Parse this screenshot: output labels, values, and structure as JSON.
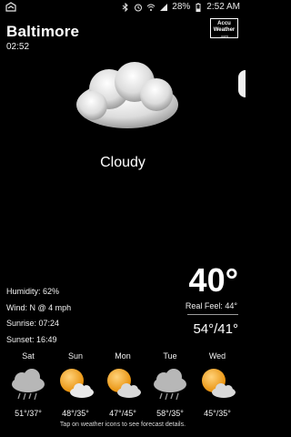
{
  "status_bar": {
    "battery": "28%",
    "time": "2:52 AM",
    "icons": [
      "notification-icon",
      "bluetooth-icon",
      "alarm-icon",
      "wifi-icon",
      "signal-icon",
      "battery-icon"
    ]
  },
  "location": {
    "city": "Baltimore",
    "time": "02:52"
  },
  "brand": {
    "line1": "Accu",
    "line2": "Weather",
    "line3": ".com"
  },
  "current": {
    "condition": "Cloudy",
    "temperature": "40°",
    "real_feel": "Real Feel: 44°",
    "hi_lo": "54°/41°",
    "humidity": "Humidity: 62%",
    "wind": "Wind: N @ 4 mph",
    "sunrise": "Sunrise: 07:24",
    "sunset": "Sunset: 16:49",
    "icon": "cloud-icon"
  },
  "forecast": [
    {
      "day": "Sat",
      "range": "51°/37°",
      "icon": "rain-cloud-icon"
    },
    {
      "day": "Sun",
      "range": "48°/35°",
      "icon": "partly-sunny-icon"
    },
    {
      "day": "Mon",
      "range": "47°/45°",
      "icon": "partly-sunny-icon"
    },
    {
      "day": "Tue",
      "range": "58°/35°",
      "icon": "rain-cloud-icon"
    },
    {
      "day": "Wed",
      "range": "45°/35°",
      "icon": "partly-sunny-icon"
    }
  ],
  "hint": "Tap on weather icons to see forecast details.",
  "colors": {
    "background": "#000000",
    "text": "#ffffff",
    "sun": "#f6a623"
  }
}
